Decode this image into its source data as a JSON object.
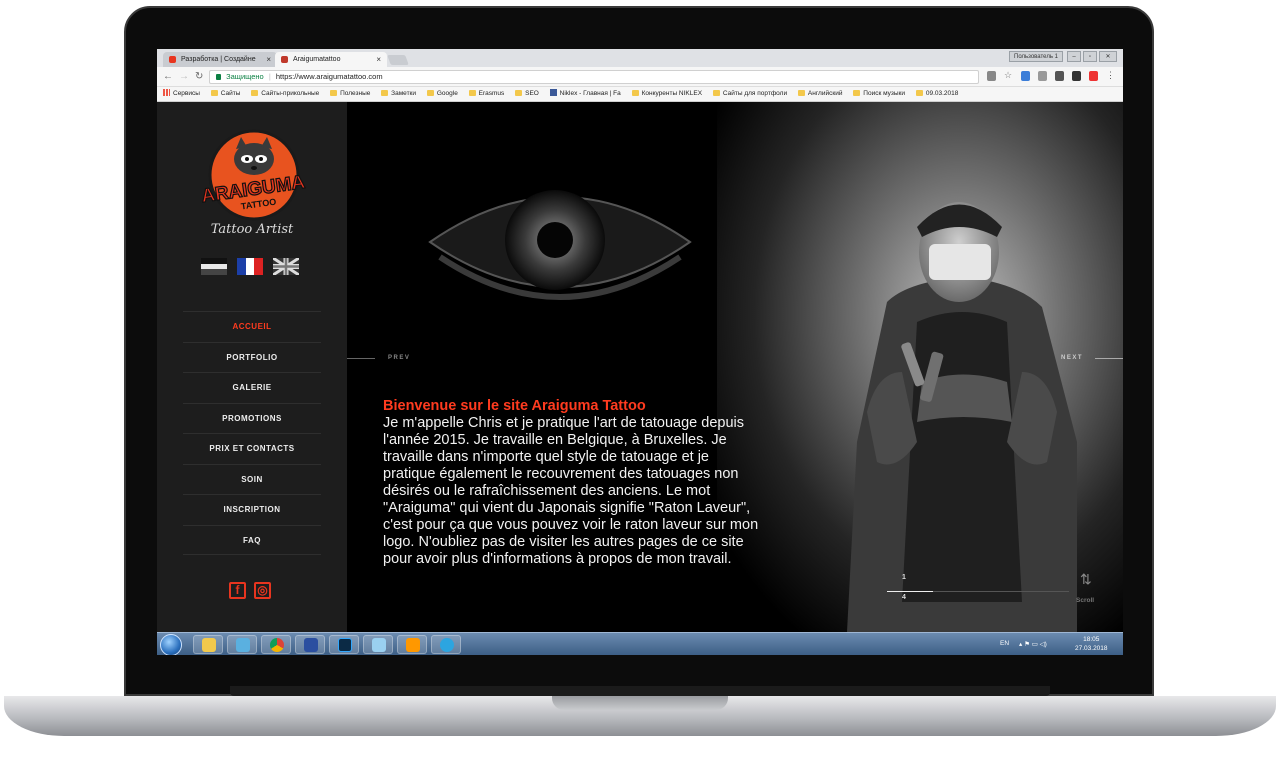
{
  "browser": {
    "tabs": [
      {
        "title": "Разработка | Создайне",
        "favicon_color": "#e8351f"
      },
      {
        "title": "Araigumatattoo",
        "favicon_color": "#c0392b"
      }
    ],
    "window_user": "Пользователь 1",
    "address": {
      "secure_label": "Защищено",
      "url": "https://www.araigumatattoo.com"
    },
    "bookmarks": [
      {
        "label": "Сервисы",
        "kind": "apps"
      },
      {
        "label": "Сайты",
        "kind": "folder"
      },
      {
        "label": "Сайты-прикольные",
        "kind": "folder"
      },
      {
        "label": "Полезные",
        "kind": "folder"
      },
      {
        "label": "Заметки",
        "kind": "folder"
      },
      {
        "label": "Google",
        "kind": "folder"
      },
      {
        "label": "Erasmus",
        "kind": "folder"
      },
      {
        "label": "SEO",
        "kind": "folder"
      },
      {
        "label": "Niklex - Главная | Fa",
        "kind": "facebook"
      },
      {
        "label": "Конкуренты NIKLEX",
        "kind": "folder"
      },
      {
        "label": "Сайты для портфоли",
        "kind": "folder"
      },
      {
        "label": "Английский",
        "kind": "folder"
      },
      {
        "label": "Поиск музыки",
        "kind": "folder"
      },
      {
        "label": "09.03.2018",
        "kind": "folder"
      }
    ]
  },
  "site": {
    "logo_text": "ARAIGUMA",
    "logo_sub": "TATTOO",
    "tagline": "Tattoo Artist",
    "menu": [
      "ACCUEIL",
      "PORTFOLIO",
      "GALERIE",
      "PROMOTIONS",
      "PRIX ET CONTACTS",
      "SOIN",
      "INSCRIPTION",
      "FAQ"
    ],
    "active_menu": "ACCUEIL",
    "accent_color": "#ff3b1f",
    "hero": {
      "prev_label": "PREV",
      "next_label": "NEXT",
      "title": "Bienvenue sur le site Araiguma Tattoo",
      "body": "Je m'appelle Chris et je pratique l'art de tatouage depuis l'année 2015. Je travaille en Belgique, à Bruxelles. Je travaille dans n'importe quel style de tatouage et je pratique également le recouvrement des tatouages non désirés ou le rafraîchissement des anciens. Le mot \"Araiguma\" qui vient du Japonais signifie \"Raton Laveur\", c'est pour ça que vous pouvez voir le raton laveur sur mon logo. N'oubliez pas de visiter les autres pages de ce site pour avoir plus d'informations à propos de mon travail.",
      "slide_current": "1",
      "slide_total": "4",
      "progress": 0.25,
      "scroll_label": "Scroll"
    }
  },
  "taskbar": {
    "apps": [
      "explorer",
      "network",
      "chrome",
      "save",
      "photoshop",
      "notes",
      "sublime",
      "telegram"
    ],
    "lang": "EN",
    "time": "18:05",
    "date": "27.03.2018"
  }
}
